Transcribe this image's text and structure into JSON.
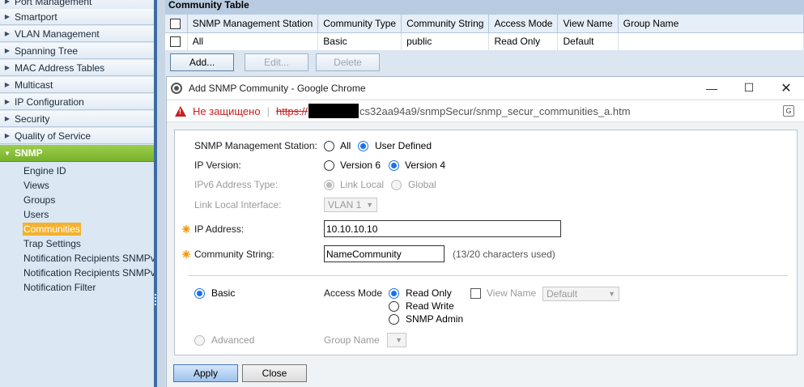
{
  "nav": {
    "items": [
      {
        "label": "Port Management",
        "expanded": false
      },
      {
        "label": "Smartport",
        "expanded": false
      },
      {
        "label": "VLAN Management",
        "expanded": false
      },
      {
        "label": "Spanning Tree",
        "expanded": false
      },
      {
        "label": "MAC Address Tables",
        "expanded": false
      },
      {
        "label": "Multicast",
        "expanded": false
      },
      {
        "label": "IP Configuration",
        "expanded": false
      },
      {
        "label": "Security",
        "expanded": false
      },
      {
        "label": "Quality of Service",
        "expanded": false
      },
      {
        "label": "SNMP",
        "expanded": true
      }
    ],
    "snmp_subitems": [
      "Engine ID",
      "Views",
      "Groups",
      "Users",
      "Communities",
      "Trap Settings",
      "Notification Recipients SNMPv",
      "Notification Recipients SNMPv",
      "Notification Filter"
    ],
    "selected_subitem": "Communities",
    "colors": {
      "active": "#8cc13f",
      "selected": "#f3b12e"
    }
  },
  "community_table": {
    "title": "Community Table",
    "columns": [
      "SNMP Management Station",
      "Community Type",
      "Community String",
      "Access Mode",
      "View Name",
      "Group Name"
    ],
    "rows": [
      {
        "station": "All",
        "type": "Basic",
        "string": "public",
        "access": "Read Only",
        "view": "Default",
        "group": ""
      }
    ],
    "buttons": {
      "add": "Add...",
      "edit": "Edit...",
      "delete": "Delete"
    }
  },
  "popup": {
    "title": "Add SNMP Community - Google Chrome",
    "address": {
      "not_secure": "Не защищено",
      "scheme": "https://",
      "path": "cs32aa94a9/snmpSecur/snmp_secur_communities_a.htm"
    },
    "form": {
      "station": {
        "label": "SNMP Management Station:",
        "options": [
          "All",
          "User Defined"
        ],
        "selected": "User Defined"
      },
      "ip_version": {
        "label": "IP Version:",
        "options": [
          "Version 6",
          "Version 4"
        ],
        "selected": "Version 4"
      },
      "ipv6_type": {
        "label": "IPv6 Address Type:",
        "options": [
          "Link Local",
          "Global"
        ],
        "selected": "Link Local",
        "disabled": true
      },
      "link_local": {
        "label": "Link Local Interface:",
        "value": "VLAN 1",
        "disabled": true
      },
      "ip_address": {
        "label": "IP Address:",
        "value": "10.10.10.10",
        "required": true
      },
      "community_string": {
        "label": "Community String:",
        "value": "NameCommunity",
        "hint": "(13/20 characters used)",
        "required": true
      },
      "basic": {
        "label": "Basic",
        "selected": true
      },
      "access_mode": {
        "label": "Access Mode",
        "options": [
          "Read Only",
          "Read Write",
          "SNMP Admin"
        ],
        "selected": "Read Only"
      },
      "view_name": {
        "label": "View Name",
        "value": "Default",
        "checked": false
      },
      "advanced": {
        "label": "Advanced",
        "selected": false
      },
      "group_name": {
        "label": "Group Name",
        "value": ""
      }
    },
    "buttons": {
      "apply": "Apply",
      "close": "Close"
    }
  }
}
